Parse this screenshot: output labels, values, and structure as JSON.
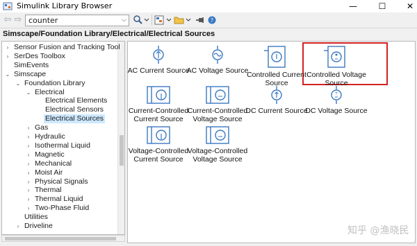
{
  "window": {
    "title": "Simulink Library Browser",
    "minimize_glyph": "—",
    "maximize_glyph": "☐",
    "close_glyph": "✕"
  },
  "toolbar": {
    "search_value": "counter",
    "icons": [
      "back-arrow-icon",
      "forward-arrow-icon",
      "search-options-icon",
      "new-model-icon",
      "open-folder-icon",
      "pin-icon",
      "help-icon"
    ]
  },
  "path": "Simscape/Foundation Library/Electrical/Electrical Sources",
  "tree": {
    "items": [
      {
        "label": "Sensor Fusion and Tracking Tool",
        "indent": 0,
        "toggle": "›"
      },
      {
        "label": "SerDes Toolbox",
        "indent": 0,
        "toggle": "›"
      },
      {
        "label": "SimEvents",
        "indent": 0,
        "toggle": ""
      },
      {
        "label": "Simscape",
        "indent": 0,
        "toggle": "⌄"
      },
      {
        "label": "Foundation Library",
        "indent": 1,
        "toggle": "⌄"
      },
      {
        "label": "Electrical",
        "indent": 2,
        "toggle": "⌄"
      },
      {
        "label": "Electrical Elements",
        "indent": 3,
        "toggle": ""
      },
      {
        "label": "Electrical Sensors",
        "indent": 3,
        "toggle": ""
      },
      {
        "label": "Electrical Sources",
        "indent": 3,
        "toggle": "",
        "selected": true
      },
      {
        "label": "Gas",
        "indent": 2,
        "toggle": "›"
      },
      {
        "label": "Hydraulic",
        "indent": 2,
        "toggle": "›"
      },
      {
        "label": "Isothermal Liquid",
        "indent": 2,
        "toggle": "›"
      },
      {
        "label": "Magnetic",
        "indent": 2,
        "toggle": "›"
      },
      {
        "label": "Mechanical",
        "indent": 2,
        "toggle": "›"
      },
      {
        "label": "Moist Air",
        "indent": 2,
        "toggle": "›"
      },
      {
        "label": "Physical Signals",
        "indent": 2,
        "toggle": "›"
      },
      {
        "label": "Thermal",
        "indent": 2,
        "toggle": "›"
      },
      {
        "label": "Thermal Liquid",
        "indent": 2,
        "toggle": "›"
      },
      {
        "label": "Two-Phase Fluid",
        "indent": 2,
        "toggle": "›"
      },
      {
        "label": "Utilities",
        "indent": 1,
        "toggle": ""
      },
      {
        "label": "Driveline",
        "indent": 1,
        "toggle": "›"
      }
    ]
  },
  "blocks": [
    {
      "name": "ac-current-source",
      "line1": "AC Current Source",
      "line2": "",
      "icon": "ac-current-icon"
    },
    {
      "name": "ac-voltage-source",
      "line1": "AC Voltage Source",
      "line2": "",
      "icon": "ac-voltage-icon"
    },
    {
      "name": "controlled-current-source",
      "line1": "Controlled Current",
      "line2": "Source",
      "icon": "controlled-current-icon"
    },
    {
      "name": "controlled-voltage-source",
      "line1": "Controlled Voltage",
      "line2": "Source",
      "icon": "controlled-voltage-icon"
    },
    {
      "name": "current-controlled-current-source",
      "line1": "Current-Controlled",
      "line2": "Current Source",
      "icon": "cccs-icon"
    },
    {
      "name": "current-controlled-voltage-source",
      "line1": "Current-Controlled",
      "line2": "Voltage Source",
      "icon": "ccvs-icon"
    },
    {
      "name": "dc-current-source",
      "line1": "DC Current Source",
      "line2": "",
      "icon": "dc-current-icon"
    },
    {
      "name": "dc-voltage-source",
      "line1": "DC Voltage Source",
      "line2": "",
      "icon": "dc-voltage-icon"
    },
    {
      "name": "voltage-controlled-current-source",
      "line1": "Voltage-Controlled",
      "line2": "Current Source",
      "icon": "vccs-icon"
    },
    {
      "name": "voltage-controlled-voltage-source",
      "line1": "Voltage-Controlled",
      "line2": "Voltage Source",
      "icon": "vcvs-icon"
    }
  ],
  "watermark": "知乎 @渔晓民",
  "colors": {
    "block_icon": "#3a78c2",
    "highlight": "#d42020",
    "selection": "#cde8ff"
  }
}
